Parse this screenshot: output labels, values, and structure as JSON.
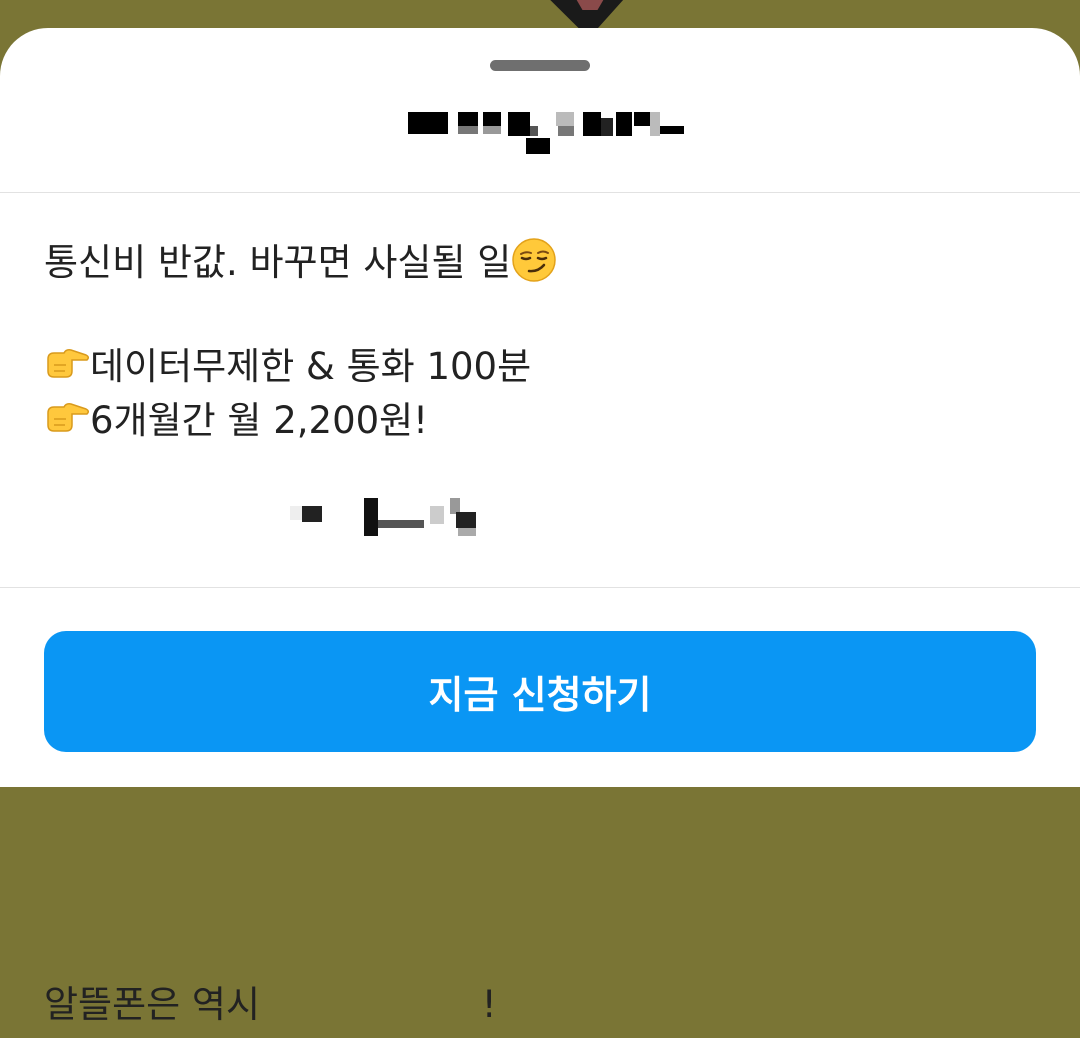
{
  "sheet": {
    "message_lines": [
      "통신비 반값. 바꾸면 사실될 일",
      "데이터무제한 & 통화 100분",
      "6개월간 월 2,200원!",
      "알뜰폰은 역시 "
    ],
    "closing_punctuation": "!",
    "icons": {
      "smirk": "smirking-face-emoji",
      "point": "backhand-index-pointing-right-emoji"
    }
  },
  "cta": {
    "label": "지금 신청하기"
  },
  "colors": {
    "cta_background": "#0a96f4",
    "sheet_background": "#ffffff",
    "backdrop": "#7a7535",
    "text": "#222222"
  }
}
